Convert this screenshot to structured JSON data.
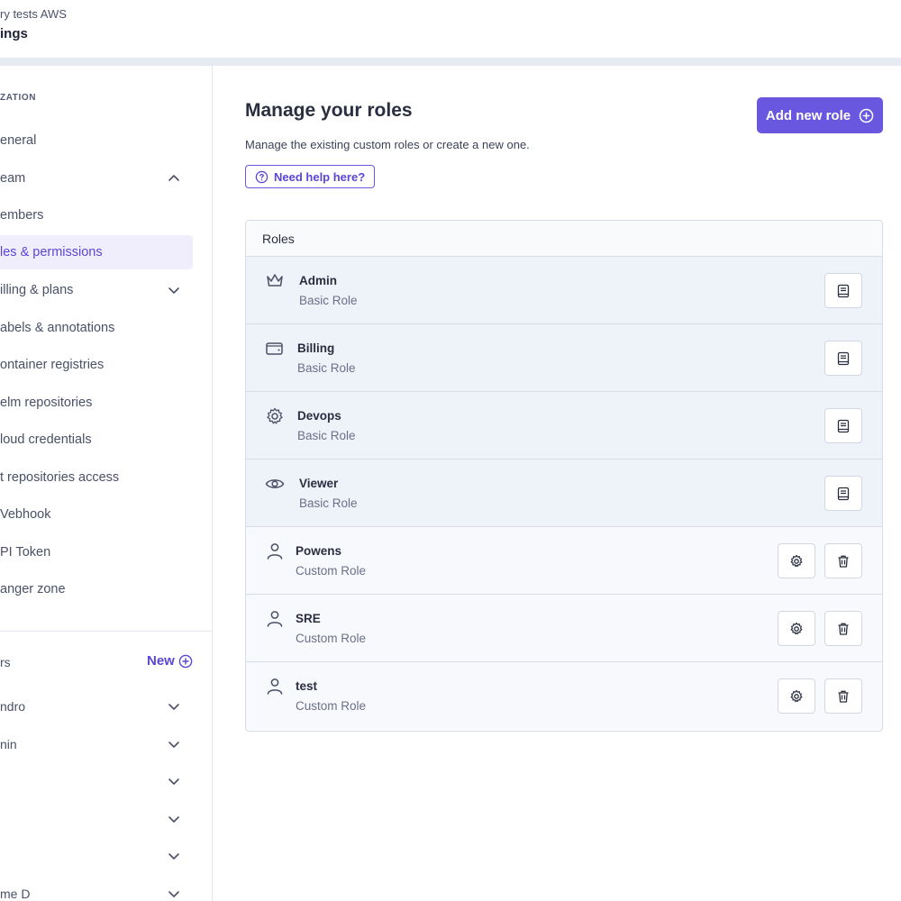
{
  "header": {
    "breadcrumb": "ry tests AWS",
    "title": "ings"
  },
  "sidebar": {
    "section_label": "ZATION",
    "items": [
      {
        "label": "eneral",
        "chevron": "none",
        "active": false
      },
      {
        "label": "eam",
        "chevron": "up",
        "active": false
      },
      {
        "label": "embers",
        "chevron": "none",
        "active": false
      },
      {
        "label": "les & permissions",
        "chevron": "none",
        "active": true
      },
      {
        "label": "illing & plans",
        "chevron": "down",
        "active": false
      },
      {
        "label": "abels & annotations",
        "chevron": "none",
        "active": false
      },
      {
        "label": "ontainer registries",
        "chevron": "none",
        "active": false
      },
      {
        "label": "elm repositories",
        "chevron": "none",
        "active": false
      },
      {
        "label": "loud credentials",
        "chevron": "none",
        "active": false
      },
      {
        "label": "t repositories access",
        "chevron": "none",
        "active": false
      },
      {
        "label": "Vebhook",
        "chevron": "none",
        "active": false
      },
      {
        "label": "PI Token",
        "chevron": "none",
        "active": false
      },
      {
        "label": "anger zone",
        "chevron": "none",
        "active": false
      }
    ],
    "clusters_label": "rs",
    "new_label": "New",
    "cluster_items": [
      {
        "label": "ndro"
      },
      {
        "label": "nin"
      },
      {
        "label": ""
      },
      {
        "label": ""
      },
      {
        "label": ""
      },
      {
        "label": "me D"
      }
    ]
  },
  "main": {
    "title": "Manage your roles",
    "description": "Manage the existing custom roles or create a new one.",
    "help_label": "Need help here?",
    "add_role_label": "Add new role",
    "table_header": "Roles",
    "roles": [
      {
        "name": "Admin",
        "type": "Basic Role",
        "icon": "crown-icon",
        "kind": "basic"
      },
      {
        "name": "Billing",
        "type": "Basic Role",
        "icon": "wallet-icon",
        "kind": "basic"
      },
      {
        "name": "Devops",
        "type": "Basic Role",
        "icon": "gear-icon",
        "kind": "basic"
      },
      {
        "name": "Viewer",
        "type": "Basic Role",
        "icon": "eye-icon",
        "kind": "basic"
      },
      {
        "name": "Powens",
        "type": "Custom Role",
        "icon": "user-icon",
        "kind": "custom"
      },
      {
        "name": "SRE",
        "type": "Custom Role",
        "icon": "user-icon",
        "kind": "custom"
      },
      {
        "name": "test",
        "type": "Custom Role",
        "icon": "user-icon",
        "kind": "custom"
      }
    ]
  },
  "colors": {
    "accent": "#6a57e0",
    "accent_text": "#5a46d6",
    "basic_row_bg": "#eef2f9",
    "custom_row_bg": "#f7f9fc"
  }
}
